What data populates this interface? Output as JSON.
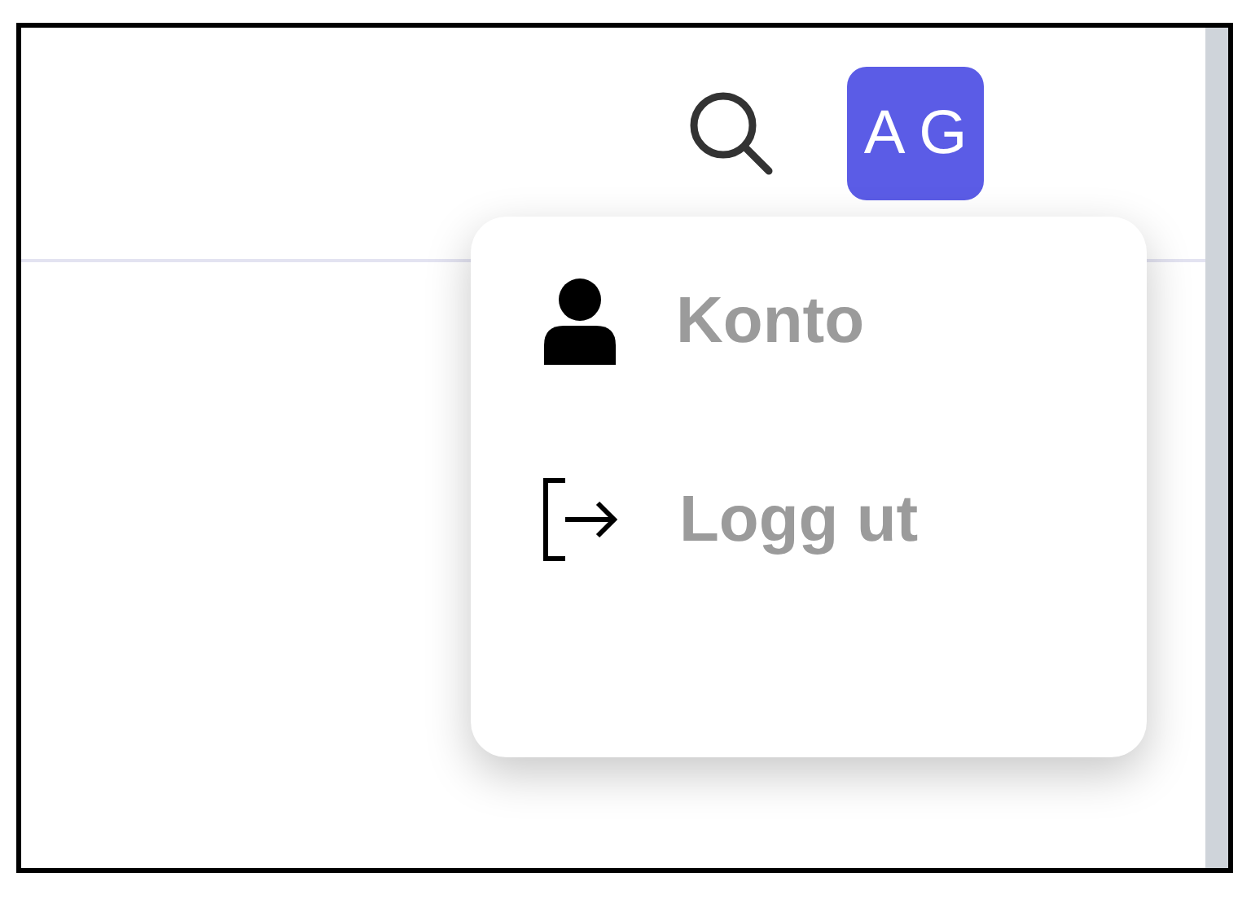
{
  "header": {
    "avatar": {
      "initials": "A G"
    }
  },
  "menu": {
    "items": [
      {
        "label": "Konto",
        "kind": "account"
      },
      {
        "label": "Logg ut",
        "kind": "logout"
      }
    ]
  }
}
